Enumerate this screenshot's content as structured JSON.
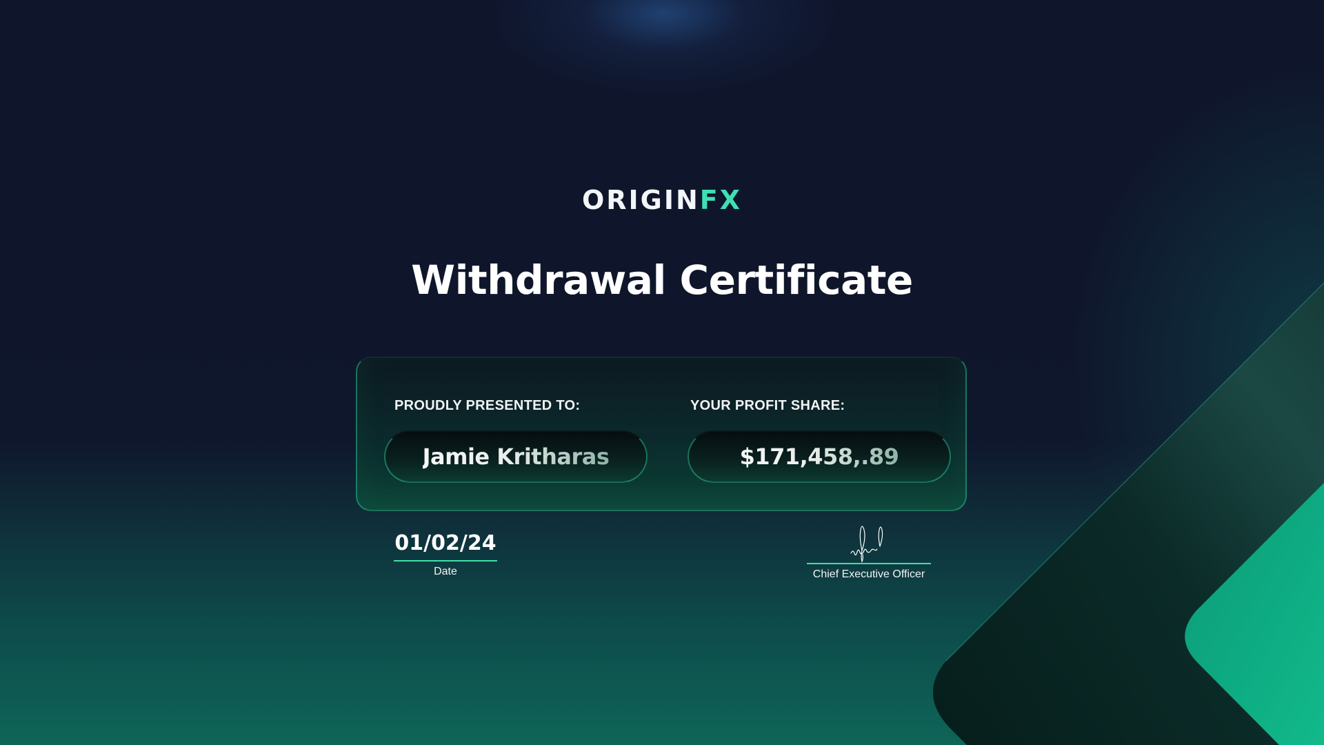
{
  "brand": {
    "logo_main": "ORIGIN",
    "logo_accent": "FX"
  },
  "certificate": {
    "title": "Withdrawal Certificate",
    "presented_label": "PROUDLY PRESENTED TO:",
    "recipient_name": "Jamie Kritharas",
    "profit_label": "YOUR PROFIT SHARE:",
    "profit_amount": "$171,458,.89",
    "date_value": "01/02/24",
    "date_caption": "Date",
    "signature_caption": "Chief Executive Officer"
  },
  "colors": {
    "accent": "#3ee0b2",
    "underline": "#3de3a8",
    "background_top": "#0f152b",
    "background_bottom": "#0e6558"
  }
}
